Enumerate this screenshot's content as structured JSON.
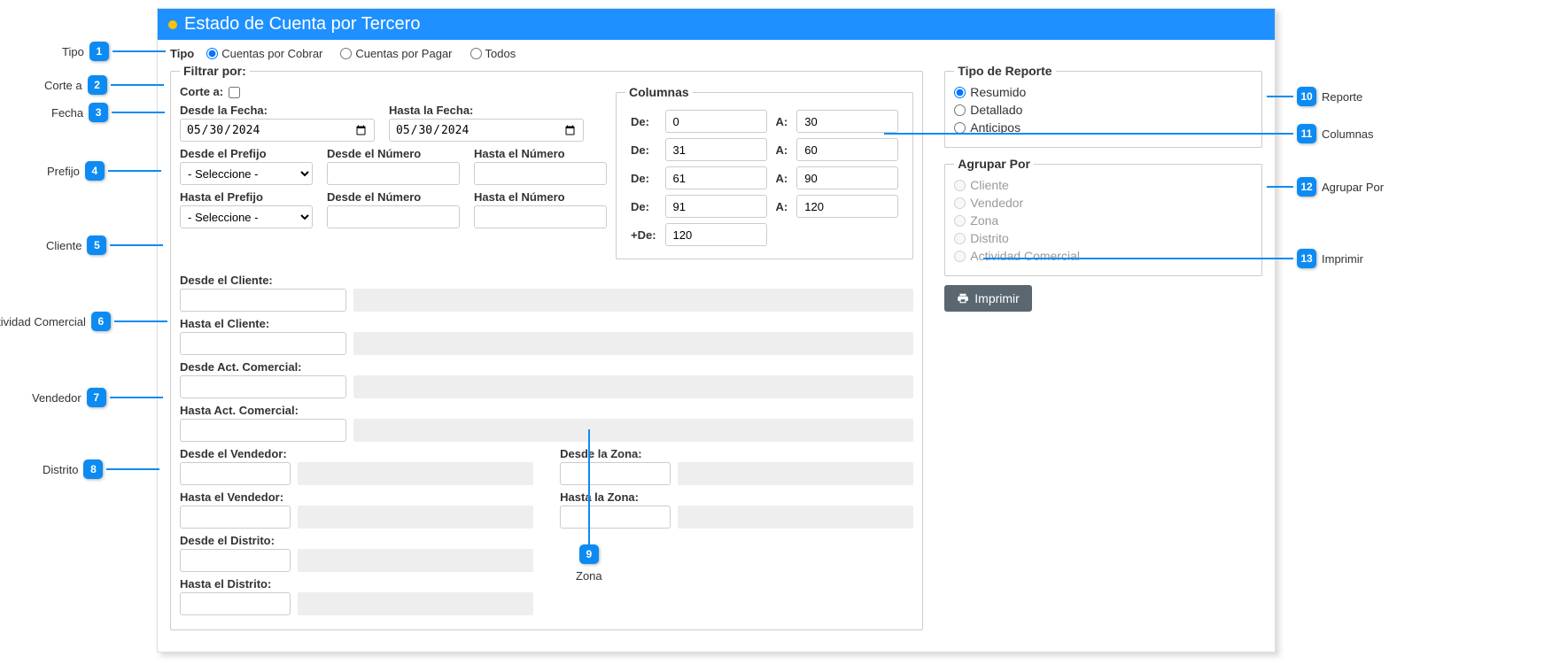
{
  "header": {
    "title": "Estado de Cuenta por Tercero"
  },
  "tipo": {
    "label": "Tipo",
    "opt1": "Cuentas por Cobrar",
    "opt2": "Cuentas por Pagar",
    "opt3": "Todos"
  },
  "filtrar": {
    "legend": "Filtrar por:",
    "corte_label": "Corte a:",
    "desde_fecha_label": "Desde la Fecha:",
    "hasta_fecha_label": "Hasta la Fecha:",
    "fecha_val": "30/05/2024",
    "desde_prefijo_label": "Desde el Prefijo",
    "hasta_prefijo_label": "Hasta el Prefijo",
    "desde_numero_label": "Desde el Número",
    "hasta_numero_label": "Hasta el Número",
    "seleccione": "- Seleccione -",
    "desde_cliente_label": "Desde el Cliente:",
    "hasta_cliente_label": "Hasta el Cliente:",
    "desde_act_label": "Desde Act. Comercial:",
    "hasta_act_label": "Hasta Act. Comercial:",
    "desde_vendedor_label": "Desde el Vendedor:",
    "hasta_vendedor_label": "Hasta el Vendedor:",
    "desde_zona_label": "Desde la Zona:",
    "hasta_zona_label": "Hasta la Zona:",
    "desde_distrito_label": "Desde el Distrito:",
    "hasta_distrito_label": "Hasta el Distrito:"
  },
  "columnas": {
    "legend": "Columnas",
    "de": "De:",
    "a": "A:",
    "mas_de": "+De:",
    "vals": {
      "d1": "0",
      "a1": "30",
      "d2": "31",
      "a2": "60",
      "d3": "61",
      "a3": "90",
      "d4": "91",
      "a4": "120",
      "d5": "120"
    }
  },
  "reporte": {
    "legend": "Tipo de Reporte",
    "opt1": "Resumido",
    "opt2": "Detallado",
    "opt3": "Anticipos"
  },
  "agrupar": {
    "legend": "Agrupar Por",
    "opt1": "Cliente",
    "opt2": "Vendedor",
    "opt3": "Zona",
    "opt4": "Distrito",
    "opt5": "Actividad Comercial"
  },
  "btn_imprimir": "Imprimir",
  "callouts": {
    "c1": "Tipo",
    "c2": "Corte a",
    "c3": "Fecha",
    "c4": "Prefijo",
    "c5": "Cliente",
    "c6": "Actividad Comercial",
    "c7": "Vendedor",
    "c8": "Distrito",
    "c9": "Zona",
    "c10": "Reporte",
    "c11": "Columnas",
    "c12": "Agrupar Por",
    "c13": "Imprimir"
  }
}
